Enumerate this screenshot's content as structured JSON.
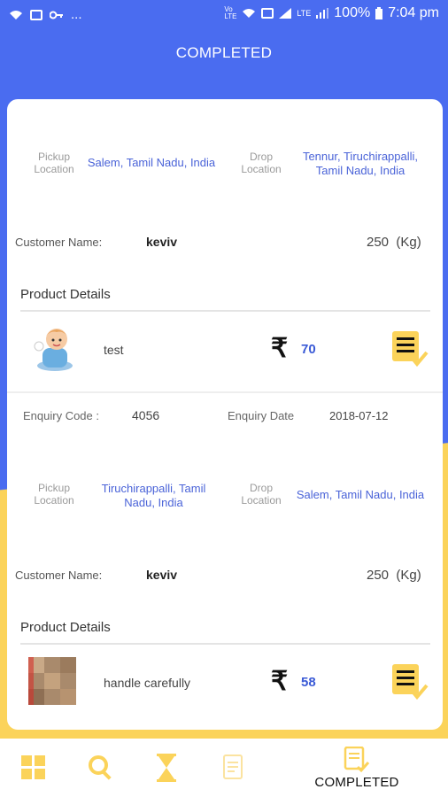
{
  "status_bar": {
    "battery": "100%",
    "time": "7:04 pm",
    "left_dots": "..."
  },
  "header": {
    "title": "COMPLETED"
  },
  "orders": [
    {
      "pickup_label": "Pickup Location",
      "pickup_value": "Salem, Tamil Nadu, India",
      "drop_label": "Drop Location",
      "drop_value": "Tennur, Tiruchirappalli, Tamil Nadu, India",
      "customer_label": "Customer Name:",
      "customer_name": "keviv",
      "weight": "250  (Kg)",
      "product_details_title": "Product Details",
      "product_name": "test",
      "currency": "₹",
      "price": "70",
      "enquiry_code_label": "Enquiry Code :",
      "enquiry_code": "4056",
      "enquiry_date_label": "Enquiry Date",
      "enquiry_date": "2018-07-12"
    },
    {
      "pickup_label": "Pickup Location",
      "pickup_value": "Tiruchirappalli, Tamil Nadu, India",
      "drop_label": "Drop Location",
      "drop_value": "Salem, Tamil Nadu, India",
      "customer_label": "Customer Name:",
      "customer_name": "keviv",
      "weight": "250  (Kg)",
      "product_details_title": "Product Details",
      "product_name": "handle carefully",
      "currency": "₹",
      "price": "58"
    }
  ],
  "bottom_nav": {
    "items": [
      {
        "icon": "grid-icon"
      },
      {
        "icon": "search-icon"
      },
      {
        "icon": "hourglass-icon"
      },
      {
        "icon": "document-icon"
      },
      {
        "icon": "completed-icon",
        "label": "COMPLETED"
      }
    ]
  },
  "colors": {
    "primary_blue": "#4a6cf0",
    "accent_yellow": "#fbd35a",
    "link_blue": "#4a63d8"
  }
}
